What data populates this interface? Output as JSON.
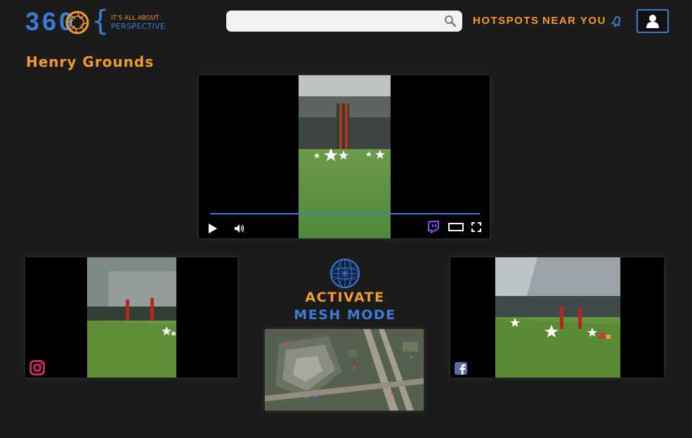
{
  "header": {
    "logo": {
      "number": "360",
      "bracket": "{",
      "tagline_top": "IT'S ALL ABOUT",
      "tagline_bottom": "PERSPECTIVE"
    },
    "search": {
      "placeholder": "",
      "value": ""
    },
    "nav": {
      "hotspots": "HOTSPOTS",
      "near_you": "NEAR YOU"
    },
    "icons": {
      "search": "search-icon",
      "notifications": "bell-icon",
      "user": "user-icon"
    }
  },
  "page": {
    "title": "Henry Grounds"
  },
  "main_video": {
    "source_icon": "twitch-icon",
    "controls": [
      "play-icon",
      "volume-icon",
      "twitch-icon",
      "theater-mode-icon",
      "fullscreen-icon"
    ]
  },
  "side_videos": [
    {
      "source_icon": "instagram-icon"
    },
    {
      "source_icon": "facebook-icon"
    }
  ],
  "mesh": {
    "line1": "ACTIVATE",
    "line2": "MESH MODE",
    "icon": "globe-icon"
  },
  "colors": {
    "accent_orange": "#f29a2e",
    "accent_blue": "#3a7bd5",
    "background": "#1b1b1b"
  }
}
